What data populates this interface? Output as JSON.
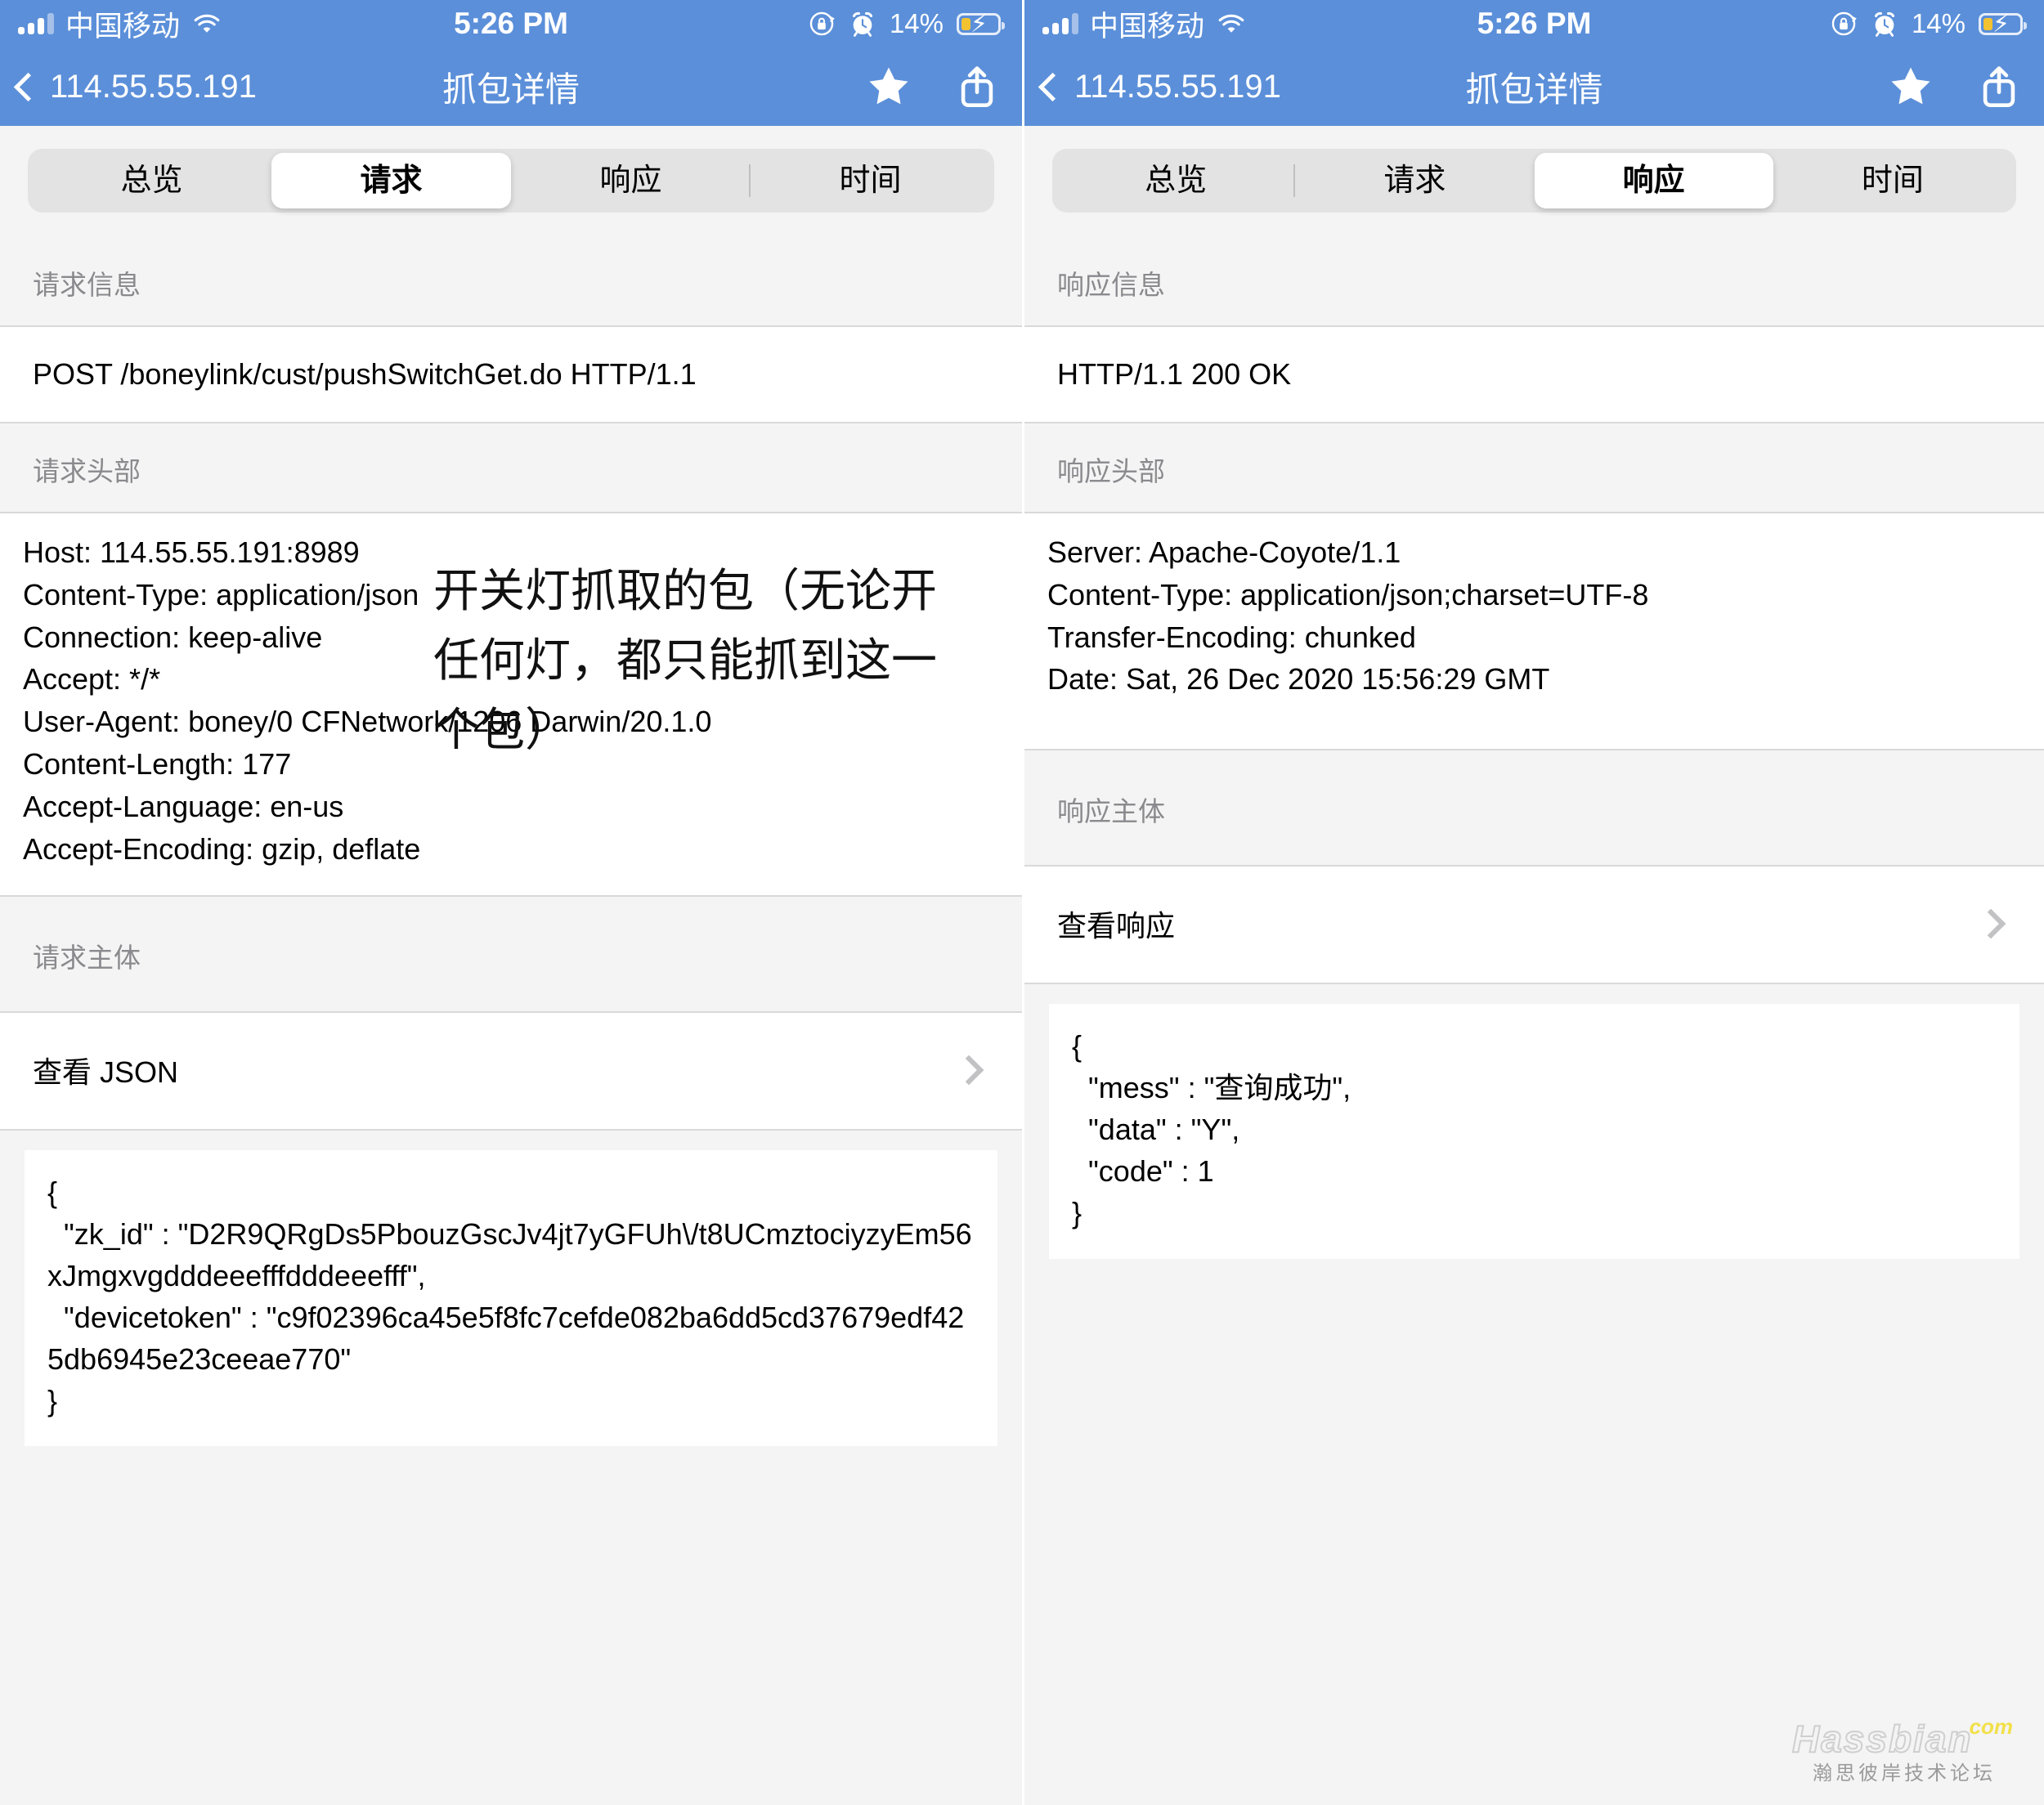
{
  "status_bar": {
    "carrier": "中国移动",
    "time": "5:26 PM",
    "battery_percent": "14%",
    "signal_icon": "signal-bars-icon",
    "wifi_icon": "wifi-icon",
    "rotation_lock_icon": "rotation-lock-icon",
    "alarm_icon": "alarm-clock-icon",
    "battery_icon": "battery-charging-icon"
  },
  "nav_bar": {
    "back_label": "114.55.55.191",
    "title": "抓包详情",
    "star_icon": "star-icon",
    "share_icon": "share-icon"
  },
  "tabs": [
    {
      "label": "总览"
    },
    {
      "label": "请求"
    },
    {
      "label": "响应"
    },
    {
      "label": "时间"
    }
  ],
  "left_panel": {
    "active_tab": "请求",
    "request_info": {
      "header": "请求信息",
      "line": "POST /boneylink/cust/pushSwitchGet.do HTTP/1.1"
    },
    "request_headers": {
      "header": "请求头部",
      "lines": [
        "Host: 114.55.55.191:8989",
        "Content-Type: application/json",
        "Connection: keep-alive",
        "Accept: */*",
        "User-Agent: boney/0 CFNetwork/1206 Darwin/20.1.0",
        "Content-Length: 177",
        "Accept-Language: en-us",
        "Accept-Encoding: gzip, deflate"
      ]
    },
    "request_body": {
      "header": "请求主体",
      "view_row_label": "查看 JSON",
      "json": "{\n  \"zk_id\" : \"D2R9QRgDs5PbouzGscJv4jt7yGFUh\\/t8UCmztociyzyEm56xJmgxvgdddeeefffdddeeefff\",\n  \"devicetoken\" : \"c9f02396ca45e5f8fc7cefde082ba6dd5cd37679edf425db6945e23ceeae770\"\n}"
    },
    "annotation": "开关灯抓取的包（无论开任何灯，都只能抓到这一个包）"
  },
  "right_panel": {
    "active_tab": "响应",
    "response_info": {
      "header": "响应信息",
      "line": "HTTP/1.1 200 OK"
    },
    "response_headers": {
      "header": "响应头部",
      "lines": [
        "Server: Apache-Coyote/1.1",
        "Content-Type: application/json;charset=UTF-8",
        "Transfer-Encoding: chunked",
        "Date: Sat, 26 Dec 2020 15:56:29 GMT"
      ]
    },
    "response_body": {
      "header": "响应主体",
      "view_row_label": "查看响应",
      "json": "{\n  \"mess\" : \"查询成功\",\n  \"data\" : \"Y\",\n  \"code\" : 1\n}"
    }
  },
  "watermark": {
    "main": "Hassbian",
    "suffix": "com",
    "sub": "瀚思彼岸技术论坛"
  },
  "colors": {
    "nav_blue": "#5b8fd9",
    "page_gray": "#f4f4f4",
    "segment_bg": "#e3e3e4",
    "battery_yellow": "#f2c230"
  }
}
